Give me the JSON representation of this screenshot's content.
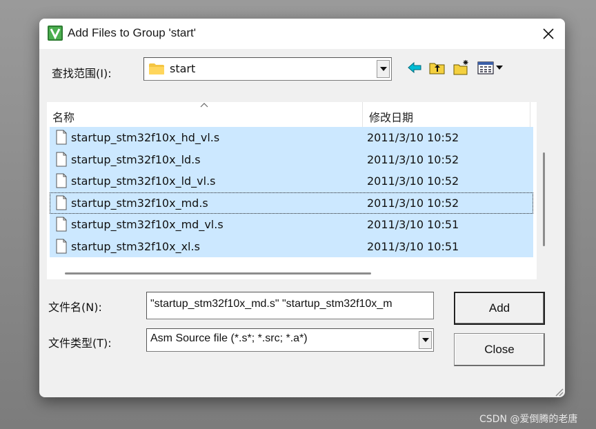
{
  "watermark": "CSDN @爱倒腾的老唐",
  "dialog": {
    "title": "Add Files to Group 'start'",
    "app_icon": "keil-uvision-icon",
    "close_icon": "close-icon"
  },
  "look_in": {
    "label": "查找范围(I):",
    "value": "start",
    "toolbar_icons": [
      "back-arrow-icon",
      "up-folder-icon",
      "new-folder-icon",
      "view-menu-icon"
    ]
  },
  "file_list": {
    "columns": [
      "名称",
      "修改日期"
    ],
    "sort_column": "名称",
    "rows": [
      {
        "name": "startup_stm32f10x_hd_vl.s",
        "date": "2011/3/10 10:52",
        "selected": true
      },
      {
        "name": "startup_stm32f10x_ld.s",
        "date": "2011/3/10 10:52",
        "selected": true
      },
      {
        "name": "startup_stm32f10x_ld_vl.s",
        "date": "2011/3/10 10:52",
        "selected": true
      },
      {
        "name": "startup_stm32f10x_md.s",
        "date": "2011/3/10 10:52",
        "selected": true,
        "focused": true
      },
      {
        "name": "startup_stm32f10x_md_vl.s",
        "date": "2011/3/10 10:51",
        "selected": true
      },
      {
        "name": "startup_stm32f10x_xl.s",
        "date": "2011/3/10 10:51",
        "selected": true
      }
    ]
  },
  "file_name": {
    "label": "文件名(N):",
    "value": "\"startup_stm32f10x_md.s\" \"startup_stm32f10x_m"
  },
  "file_type": {
    "label": "文件类型(T):",
    "value": "Asm Source file (*.s*; *.src; *.a*)"
  },
  "buttons": {
    "add": "Add",
    "close": "Close"
  },
  "colors": {
    "selection": "#cce8ff",
    "dialog_bg": "#f0f0f0"
  }
}
